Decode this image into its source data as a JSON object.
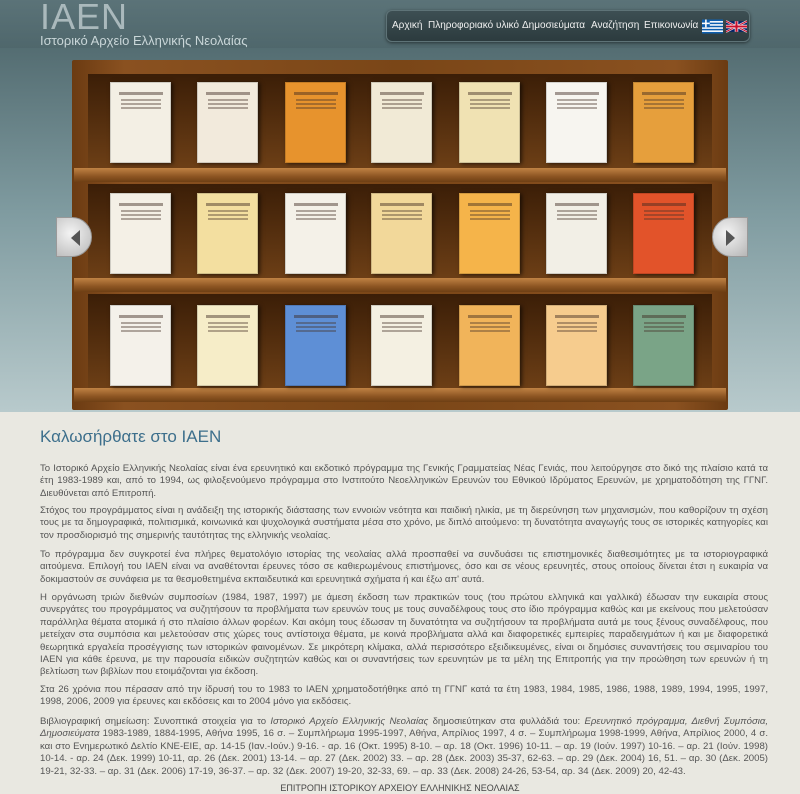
{
  "header": {
    "logo": "IAEN",
    "subtitle": "Ιστορικό Αρχείο Ελληνικής Νεολαίας",
    "nav": [
      "Αρχική",
      "Πληροφοριακό υλικό",
      "Δημοσιεύματα",
      "Αναζήτηση",
      "Επικοινωνία"
    ],
    "flags": [
      "greek-flag-icon",
      "uk-flag-icon"
    ]
  },
  "shelf": {
    "rows": [
      [
        "#f3efe4",
        "#f2eadc",
        "#e7932d",
        "#f1ead6",
        "#f0e2b3",
        "#f7f5f0",
        "#e69f3c"
      ],
      [
        "#f4f0e6",
        "#f3dfa0",
        "#f4f1e8",
        "#f2d89a",
        "#f5b44a",
        "#f2efe6",
        "#e2532a"
      ],
      [
        "#f4f1ea",
        "#f6edc8",
        "#5e8fd6",
        "#f4f0e2",
        "#f1b45a",
        "#f6cc8e",
        "#7aa487"
      ]
    ]
  },
  "content": {
    "welcome": "Καλωσήρθατε στο ΙΑΕΝ",
    "p1": "Το Ιστορικό Αρχείο Ελληνικής Νεολαίας είναι ένα ερευνητικό και εκδοτικό πρόγραμμα της Γενικής Γραμματείας Νέας Γενιάς, που λειτούργησε στο δικό της πλαίσιο κατά τα έτη 1983-1989 και, από το 1994, ως φιλοξενούμενο πρόγραμμα στο Ινστιτούτο Νεοελληνικών Ερευνών του Εθνικού Ιδρύματος Ερευνών, με χρηματοδότηση της ΓΓΝΓ. Διευθύνεται από Επιτροπή.",
    "p2": "Στόχος του προγράμματος είναι η ανάδειξη της ιστορικής διάστασης των εννοιών νεότητα και παιδική ηλικία, με τη διερεύνηση των μηχανισμών, που καθορίζουν τη σχέση τους με τα δημογραφικά, πολιτισμικά, κοινωνικά και ψυχολογικά συστήματα μέσα στο χρόνο, με διπλό αιτούμενο: τη δυνατότητα αναγωγής τους σε ιστορικές κατηγορίες και τον προσδιορισμό της σημερινής ταυτότητας της ελληνικής νεολαίας.",
    "p3": "Το πρόγραμμα δεν συγκροτεί ένα πλήρες θεματολόγιο ιστορίας της νεολαίας αλλά προσπαθεί να συνδυάσει τις επιστημονικές διαθεσιμότητες με τα ιστοριογραφικά αιτούμενα. Επιλογή του ΙΑΕΝ είναι να αναθέτονται έρευνες τόσο σε καθιερωμένους επιστήμονες, όσο και σε νέους ερευνητές, στους οποίους δίνεται έτσι η ευκαιρία να δοκιμαστούν σε συνάφεια με τα θεσμοθετημένα εκπαιδευτικά και ερευνητικά σχήματα ή και έξω απ' αυτά.",
    "p4": "Η οργάνωση τριών διεθνών συμποσίων (1984, 1987, 1997) με άμεση έκδοση των πρακτικών τους (του πρώτου ελληνικά και γαλλικά) έδωσαν την ευκαιρία στους συνεργάτες του προγράμματος να συζητήσουν τα προβλήματα των ερευνών τους με τους συναδέλφους τους στο ίδιο πρόγραμμα καθώς και με εκείνους που μελετούσαν παράλληλα θέματα ατομικά ή στο πλαίσιο άλλων φορέων. Και ακόμη τους έδωσαν τη δυνατότητα να συζητήσουν τα προβλήματα αυτά με τους ξένους συναδέλφους, που μετείχαν στα συμπόσια και μελετούσαν στις χώρες τους αντίστοιχα θέματα, με κοινά προβλήματα αλλά και διαφορετικές εμπειρίες παραδειγμάτων ή και με διαφορετικά θεωρητικά εργαλεία προσέγγισης των ιστορικών φαινομένων. Σε μικρότερη κλίμακα, αλλά περισσότερο εξειδικευμένες, είναι οι δημόσιες συναντήσεις του σεμιναρίου του ΙΑΕΝ για κάθε έρευνα, με την παρουσία ειδικών συζητητών καθώς και οι συναντήσεις των ερευνητών με τα μέλη της Επιτροπής για την προώθηση των ερευνών ή τη βελτίωση των βιβλίων που ετοιμάζονται για έκδοση.",
    "p5": "Στα 26 χρόνια που πέρασαν από την ίδρυσή του το 1983 το ΙΑΕΝ χρηματοδοτήθηκε από τη ΓΓΝΓ κατά τα έτη 1983, 1984, 1985, 1986, 1988, 1989, 1994, 1995, 1997, 1998, 2006, 2009 για έρευνες και εκδόσεις και το 2004 μόνο για εκδόσεις.",
    "p6_prefix": "Βιβλιογραφική σημείωση: Συνοπτικά στοιχεία για το ",
    "p6_italic1": "Ιστορικό Αρχείο Ελληνικής Νεολαίας",
    "p6_mid1": " δημοσιεύτηκαν στα φυλλάδιά του: ",
    "p6_italic2": "Ερευνητικό πρόγραμμα, Διεθνή Συμπόσια, Δημοσιεύματα",
    "p6_rest": " 1983-1989, 1884-1995, Αθήνα 1995, 16 σ. – Συμπλήρωμα 1995-1997, Αθήνα, Απρίλιος 1997, 4 σ. – Συμπλήρωμα 1998-1999, Αθήνα, Απρίλιος 2000, 4 σ. και στο Ενημερωτικό Δελτίο ΚΝΕ-ΕΙΕ, αρ. 14-15 (Ιαν.-Ιούν.) 9-16. - αρ. 16 (Οκτ. 1995) 8-10. – αρ. 18 (Οκτ. 1996) 10-11. – αρ. 19 (Ιούν. 1997) 10-16. – αρ. 21 (Ιούν. 1998) 10-14. - αρ. 24 (Δεκ. 1999) 10-11, αρ. 26 (Δεκ. 2001) 13-14. – αρ. 27 (Δεκ. 2002) 33. – αρ. 28 (Δεκ. 2003) 35-37, 62-63. – αρ. 29 (Δεκ. 2004) 16, 51. – αρ. 30 (Δεκ. 2005) 19-21, 32-33. – αρ. 31 (Δεκ. 2006) 17-19, 36-37. – αρ. 32 (Δεκ. 2007) 19-20, 32-33, 69. – αρ. 33 (Δεκ. 2008) 24-26, 53-54, αρ. 34 (Δεκ. 2009) 20, 42-43.",
    "footer": "ΕΠΙΤΡΟΠΗ ΙΣΤΟΡΙΚΟΥ ΑΡΧΕΙΟΥ ΕΛΛΗΝΙΚΗΣ ΝΕΟΛΑΙΑΣ"
  }
}
